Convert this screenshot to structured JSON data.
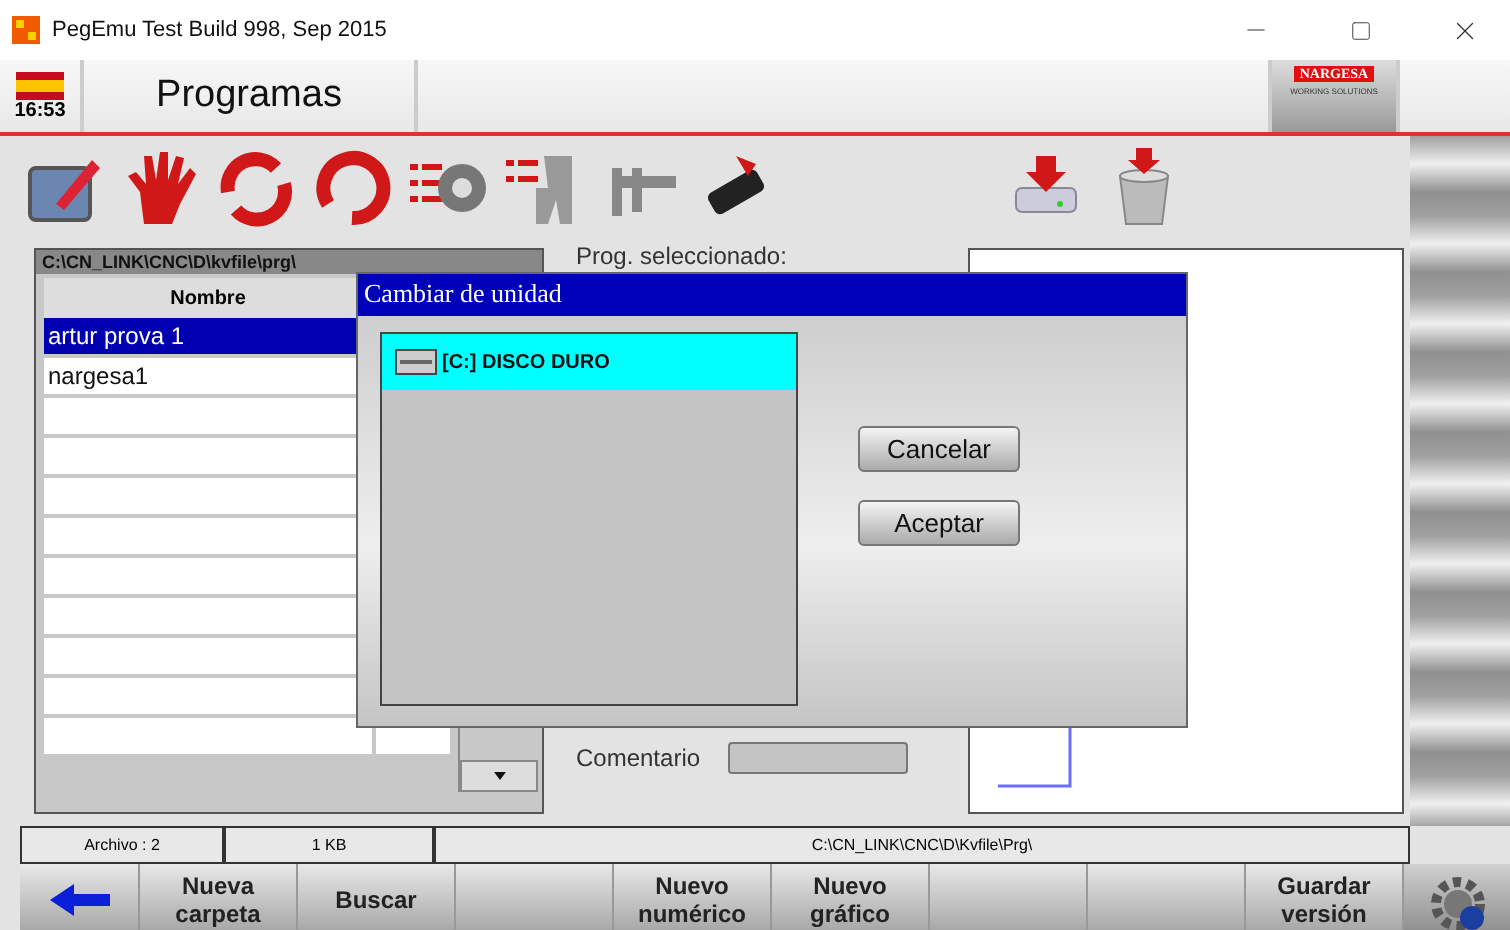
{
  "window": {
    "title": "PegEmu Test Build 998, Sep 2015"
  },
  "header": {
    "clock": "16:53",
    "title": "Programas",
    "logo": {
      "brand": "NARGESA",
      "tagline": "WORKING SOLUTIONS"
    }
  },
  "file_panel": {
    "path": "C:\\CN_LINK\\CNC\\D\\kvfile\\prg\\",
    "columns": [
      "Nombre"
    ],
    "rows": [
      {
        "name": "artur prova 1",
        "selected": true
      },
      {
        "name": "nargesa1",
        "selected": false
      }
    ]
  },
  "details": {
    "selected_label": "Prog. seleccionado:",
    "comment_label": "Comentario"
  },
  "dialog": {
    "title": "Cambiar de unidad",
    "drives": [
      {
        "label": "[C:] DISCO DURO",
        "selected": true
      }
    ],
    "buttons": [
      "Cancelar",
      "Aceptar"
    ]
  },
  "status_bar": [
    "Archivo : 2",
    "1 KB",
    "C:\\CN_LINK\\CNC\\D\\Kvfile\\Prg\\"
  ],
  "bottom_buttons": [
    {
      "kind": "back"
    },
    {
      "kind": "text",
      "lines": [
        "Nueva",
        "carpeta"
      ]
    },
    {
      "kind": "text",
      "lines": [
        "Buscar"
      ]
    },
    {
      "kind": "empty"
    },
    {
      "kind": "text",
      "lines": [
        "Nuevo",
        "numérico"
      ]
    },
    {
      "kind": "text",
      "lines": [
        "Nuevo",
        "gráfico"
      ]
    },
    {
      "kind": "empty"
    },
    {
      "kind": "empty"
    },
    {
      "kind": "text",
      "lines": [
        "Guardar",
        "versión"
      ]
    },
    {
      "kind": "settings"
    }
  ]
}
